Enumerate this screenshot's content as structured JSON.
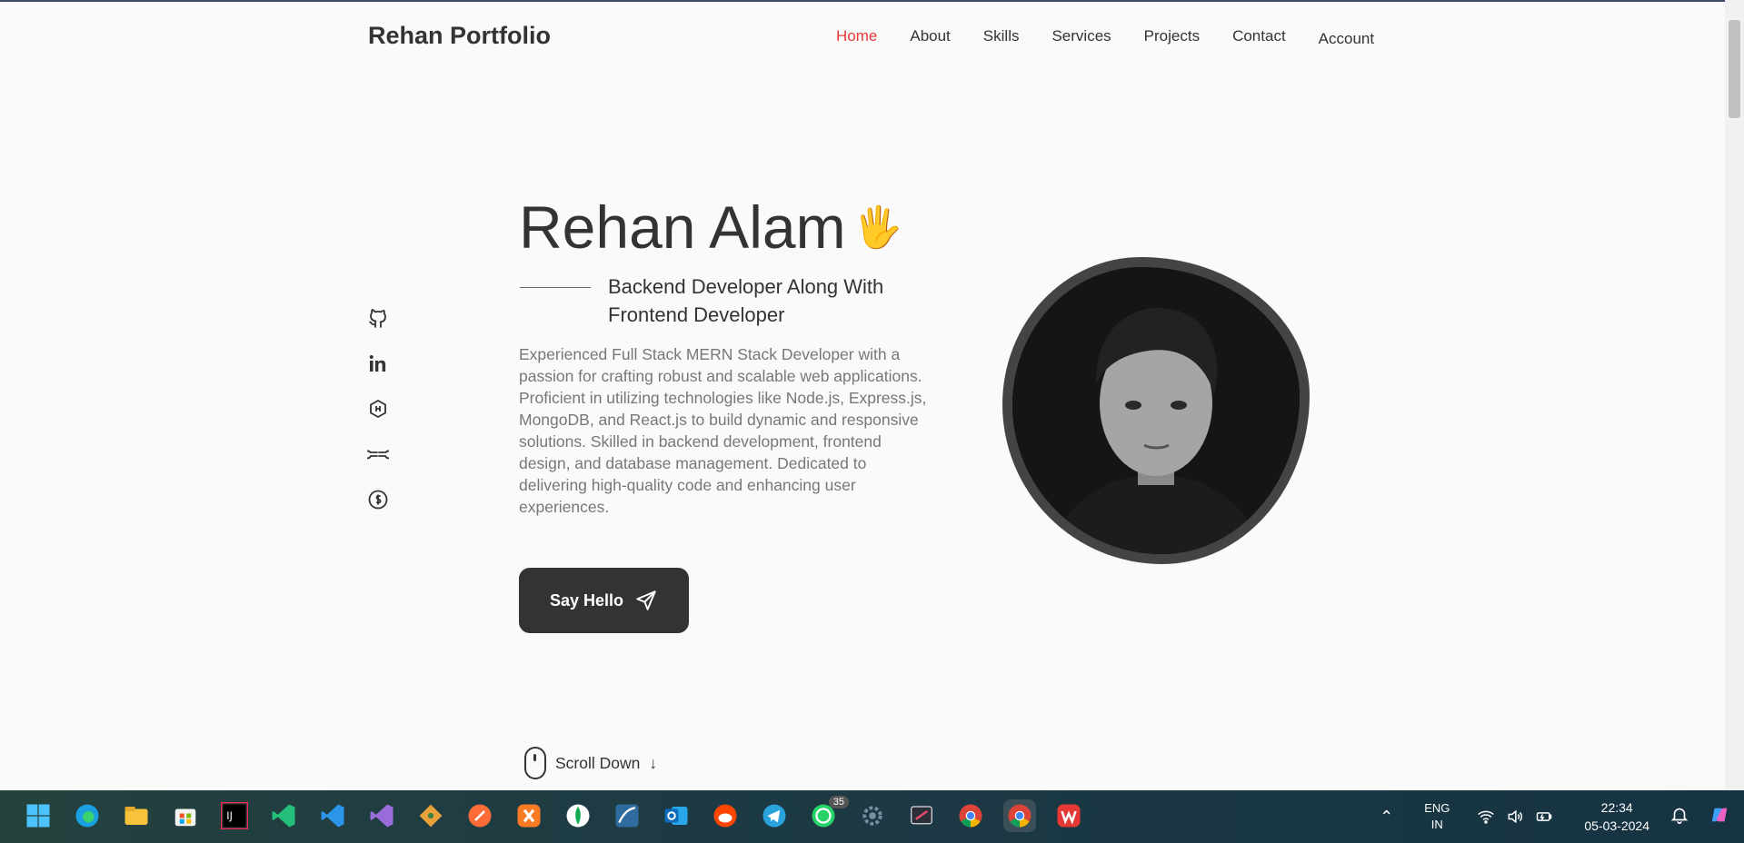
{
  "header": {
    "logo": "Rehan Portfolio",
    "nav": [
      {
        "label": "Home",
        "active": true
      },
      {
        "label": "About",
        "active": false
      },
      {
        "label": "Skills",
        "active": false
      },
      {
        "label": "Services",
        "active": false
      },
      {
        "label": "Projects",
        "active": false
      },
      {
        "label": "Contact",
        "active": false
      },
      {
        "label": "Account",
        "active": false
      }
    ]
  },
  "social": [
    "github-icon",
    "linkedin-icon",
    "hashnode-icon",
    "geeksforgeeks-icon",
    "codechef-icon"
  ],
  "hero": {
    "name": "Rehan Alam",
    "wave": "🖐",
    "subtitle": "Backend Developer Along With Frontend Developer",
    "description": "Experienced Full Stack MERN Stack Developer with a passion for crafting robust and scalable web applications. Proficient in utilizing technologies like Node.js, Express.js, MongoDB, and React.js to build dynamic and responsive solutions. Skilled in backend development, frontend design, and database management. Dedicated to delivering high-quality code and enhancing user experiences.",
    "cta_label": "Say Hello",
    "scroll_label": "Scroll Down"
  },
  "colors": {
    "accent": "#e53935",
    "dark": "#333333",
    "background": "#fafafa"
  },
  "taskbar": {
    "apps": [
      "windows-start-icon",
      "edge-icon",
      "file-explorer-icon",
      "store-icon",
      "intellij-icon",
      "vscode-icon",
      "vscode-blue-icon",
      "visual-studio-icon",
      "git-icon",
      "postman-icon",
      "xampp-icon",
      "mongodb-icon",
      "mysql-workbench-icon",
      "outlook-icon",
      "reddit-icon",
      "telegram-icon",
      "whatsapp-icon",
      "settings-icon",
      "snipping-tool-icon",
      "chrome-icon",
      "chrome-profile-icon",
      "wps-icon"
    ],
    "whatsapp_badge": "35",
    "lang_line1": "ENG",
    "lang_line2": "IN",
    "time": "22:34",
    "date": "05-03-2024"
  }
}
